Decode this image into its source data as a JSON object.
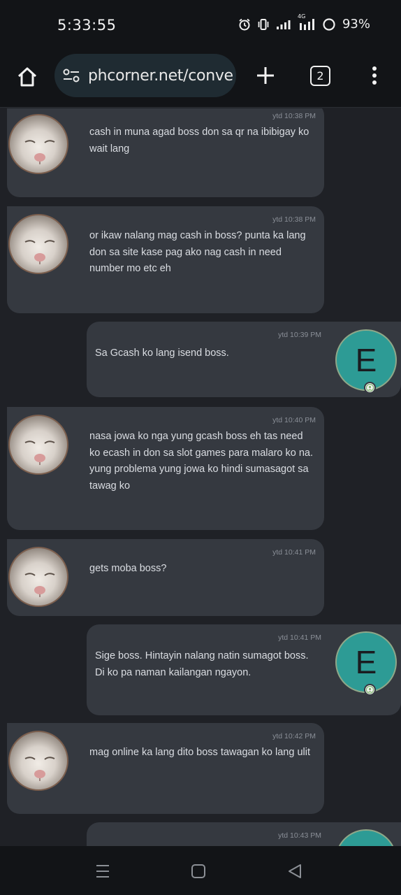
{
  "status_bar": {
    "time": "5:33:55",
    "network_label": "4G",
    "battery": "93%"
  },
  "browser": {
    "url": "phcorner.net/conve",
    "tab_count": "2",
    "icons": [
      "home-icon",
      "tune-icon",
      "plus-icon",
      "tab-switcher-icon",
      "more-vert-icon"
    ]
  },
  "conversation": {
    "messages": [
      {
        "side": "left",
        "time": "ytd 10:38 PM",
        "text": "cash in muna agad boss don sa qr na ibibigay ko wait lang"
      },
      {
        "side": "left",
        "time": "ytd 10:38 PM",
        "text": "or ikaw nalang mag cash in boss? punta ka lang don sa site kase pag ako nag cash in need number mo etc eh"
      },
      {
        "side": "right",
        "time": "ytd 10:39 PM",
        "text": "Sa Gcash ko lang isend boss.",
        "avatar_letter": "E"
      },
      {
        "side": "left",
        "time": "ytd 10:40 PM",
        "text": "nasa jowa ko nga yung gcash boss eh tas need ko ecash in don sa slot games para malaro ko na. yung problema yung jowa ko hindi sumasagot sa tawag ko"
      },
      {
        "side": "left",
        "time": "ytd 10:41 PM",
        "text": "gets moba boss?"
      },
      {
        "side": "right",
        "time": "ytd 10:41 PM",
        "text": "Sige boss. Hintayin nalang natin sumagot boss. Di ko pa naman kailangan ngayon.",
        "avatar_letter": "E"
      },
      {
        "side": "left",
        "time": "ytd 10:42 PM",
        "text": "mag online ka lang dito boss tawagan ko lang ulit"
      },
      {
        "side": "right",
        "time": "ytd 10:43 PM",
        "text": "",
        "avatar_letter": "E"
      }
    ]
  },
  "nav_bar": {
    "icons": [
      "recents-icon",
      "home-square-icon",
      "back-icon"
    ]
  },
  "colors": {
    "background": "#1f2126",
    "bubble": "#353940",
    "avatar_teal": "#2d9b95",
    "url_pill": "#1f2b32"
  }
}
